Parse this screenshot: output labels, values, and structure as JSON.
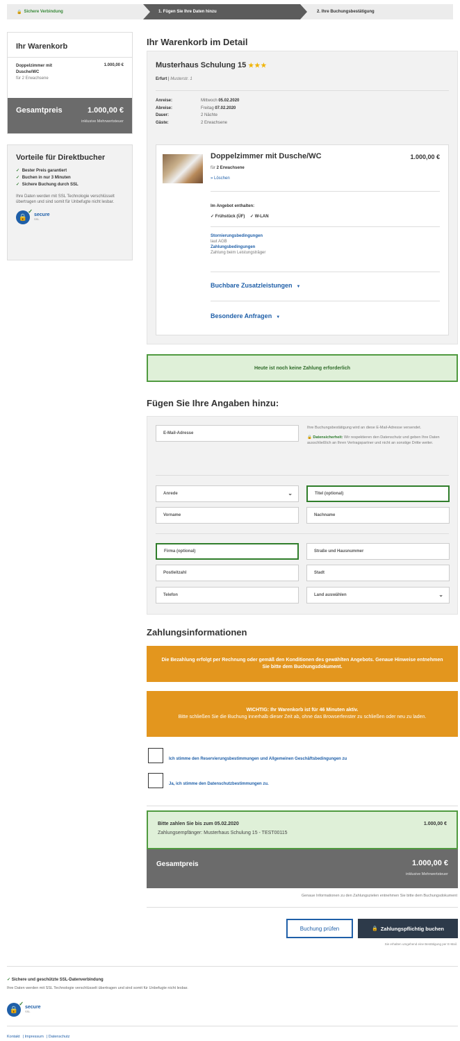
{
  "steps": {
    "step1": "Sichere Verbindung",
    "step2": "1. Fügen Sie Ihre Daten hinzu",
    "step3": "2. Ihre Buchungsbestätigung"
  },
  "cart": {
    "title": "Ihr Warenkorb",
    "item_name": "Doppelzimmer mit Dusche/WC",
    "item_price": "1.000,00 €",
    "item_sub": "für 2 Erwachsene",
    "total_label": "Gesamtpreis",
    "total_amount": "1.000,00 €",
    "vat": "inklusive Mehrwertsteuer"
  },
  "benefits": {
    "title": "Vorteile für Direktbucher",
    "items": [
      "Bester Preis garantiert",
      "Buchen in nur 3 Minuten",
      "Sichere Buchung durch SSL"
    ],
    "text": "Ihre Daten werden mit SSL Technologie verschlüsselt übertragen und sind somit für Unbefugte nicht lesbar.",
    "secure_name": "secure",
    "secure_sub": "SSL"
  },
  "detail": {
    "heading": "Ihr Warenkorb im Detail",
    "hotel": "Musterhaus Schulung 15",
    "stars": "★★★",
    "city": "Erfurt",
    "street": "Musterstr. 1",
    "stay": [
      {
        "k": "Anreise:",
        "v_pre": "Mittwoch ",
        "v_bold": "05.02.2020"
      },
      {
        "k": "Abreise:",
        "v_pre": "Freitag ",
        "v_bold": "07.02.2020"
      },
      {
        "k": "Dauer:",
        "v_pre": "2 Nächte",
        "v_bold": ""
      },
      {
        "k": "Gäste:",
        "v_pre": "2 Erwachsene",
        "v_bold": ""
      }
    ],
    "room": {
      "name": "Doppelzimmer mit Dusche/WC",
      "price": "1.000,00 €",
      "for_pre": "für ",
      "for_bold": "2 Erwachsene",
      "delete": "» Löschen",
      "incl_title": "Im Angebot enthalten:",
      "incl_items": [
        "✓ Frühstück (ÜF)",
        "✓ W-LAN"
      ],
      "storno_title": "Stornierungsbedingungen",
      "storno_text": "laut AGB",
      "payment_title": "Zahlungsbedingungen",
      "payment_text": "Zahlung beim Leistungsträger",
      "extras": "Buchbare Zusatzleistungen",
      "requests": "Besondere Anfragen"
    }
  },
  "nopay": "Heute ist noch keine Zahlung erforderlich",
  "form": {
    "heading": "Fügen Sie Ihre Angaben hinzu:",
    "email_placeholder": "E-Mail-Adresse",
    "note": "Ihre Buchungsbestätigung wird an diese E-Mail-Adresse versendet.",
    "security_label": "Datensicherheit:",
    "security_text": "Wir respektieren den Datenschutz und geben Ihre Daten ausschließlich an Ihren Vertragspartner und nicht an sonstige Dritte weiter.",
    "salutation": "Anrede",
    "title": "Titel (optional)",
    "firstname": "Vorname",
    "lastname": "Nachname",
    "company": "Firma (optional)",
    "street": "Straße und Hausnummer",
    "zip": "Postleitzahl",
    "city": "Stadt",
    "phone": "Telefon",
    "country": "Land auswählen"
  },
  "payment": {
    "heading": "Zahlungsinformationen",
    "banner1": "Die Bezahlung erfolgt per Rechnung oder gemäß den Konditionen des gewählten Angebots. Genaue Hinweise entnehmen Sie bitte dem Buchungsdokument.",
    "banner2_title": "WICHTIG: Ihr Warenkorb ist für 46 Minuten aktiv.",
    "banner2_text": "Bitte schließen Sie die Buchung innerhalb dieser Zeit ab, ohne das Browserfenster zu schließen oder neu zu laden.",
    "consent1": "Ich stimme den Reservierungsbestimmungen und Allgemeinen Geschäftsbedingungen zu",
    "consent2": "Ja, ich stimme den Datenschutzbestimmungen zu.",
    "due": "Bitte zahlen Sie bis zum 05.02.2020",
    "due_amount": "1.000,00 €",
    "recipient": "Zahlungsempfänger: Musterhaus Schulung 15 - TEST00115",
    "total_label": "Gesamtpreis",
    "total_amount": "1.000,00 €",
    "vat": "inklusive Mehrwertsteuer",
    "info": "Genaue Informationen zu den Zahlungszielen entnehmen Sie bitte dem Buchungsdokument"
  },
  "buttons": {
    "check": "Buchung prüfen",
    "book": "Zahlungspflichtig buchen",
    "note": "Sie erhalten umgehend eine Bestätigung per E-Mail."
  },
  "footer": {
    "ssl_title": "Sichere und geschützte SSL-Datenverbindung",
    "ssl_text": "Ihre Daten werden mit SSL Technologie verschlüsselt übertragen und sind somit für Unbefugte nicht lesbar.",
    "links": [
      "Kontakt",
      "Impressum",
      "Datenschutz"
    ]
  }
}
